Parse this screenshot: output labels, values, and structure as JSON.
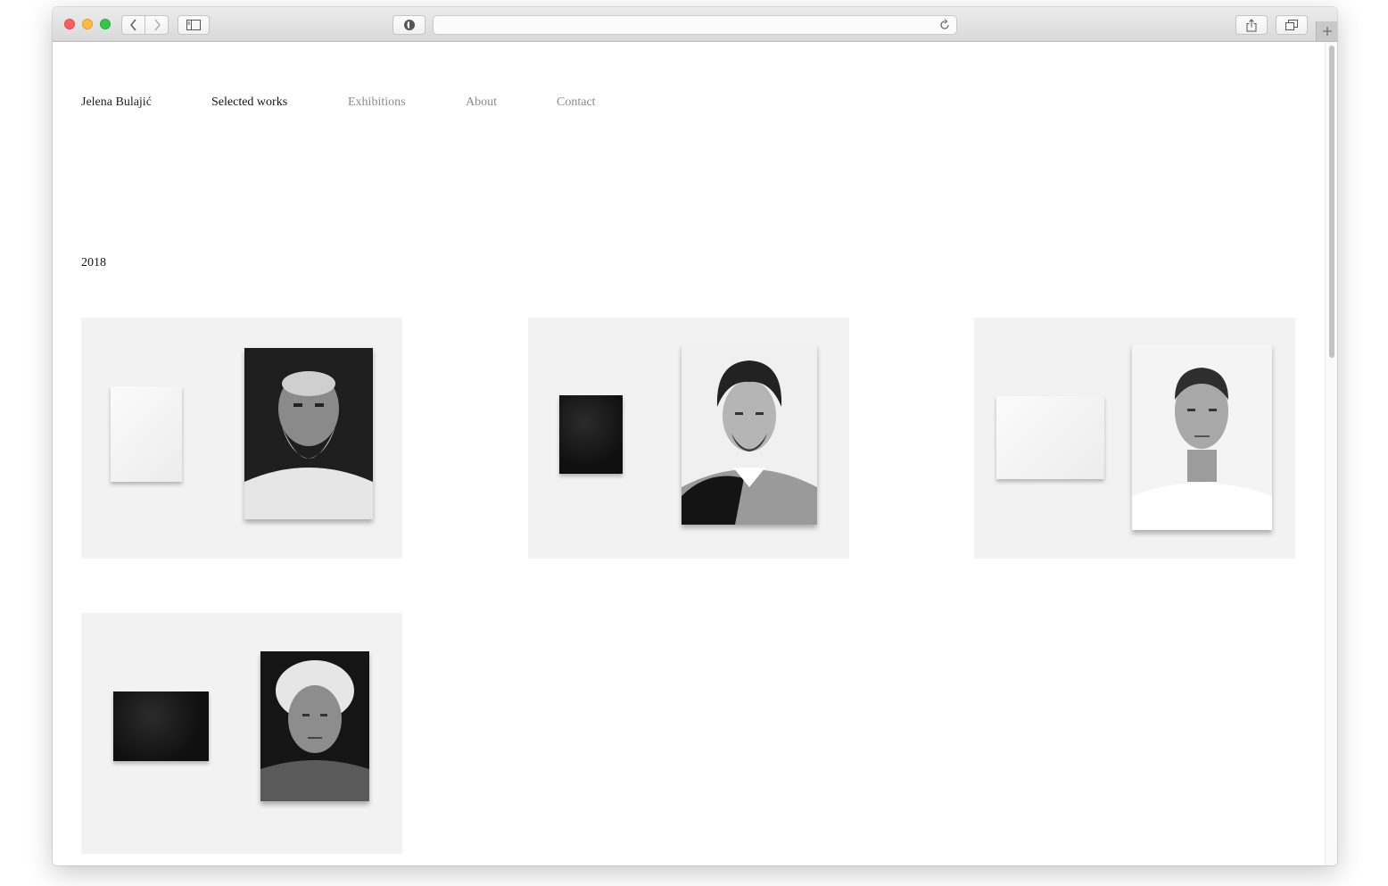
{
  "browser": {
    "back_icon": "chevron-left-icon",
    "forward_icon": "chevron-right-icon",
    "sidebar_icon": "sidebar-icon",
    "privacy_icon": "privacy-shield-icon",
    "reload_icon": "reload-icon",
    "share_icon": "share-icon",
    "tabs_icon": "tabs-icon",
    "newtab_icon": "plus-icon"
  },
  "nav": {
    "site_name": "Jelena Bulajić",
    "items": [
      "Selected works",
      "Exhibitions",
      "About",
      "Contact"
    ]
  },
  "section": {
    "year": "2018"
  },
  "works": [
    {
      "panel": "white",
      "portrait": "elderly bearded man"
    },
    {
      "panel": "black",
      "portrait": "young man with long hair"
    },
    {
      "panel": "white",
      "portrait": "young man with short hair"
    },
    {
      "panel": "black",
      "portrait": "elderly woman"
    }
  ],
  "colors": {
    "nav_active": "#111111",
    "nav_inactive": "#8a8a8a",
    "tile_background": "#f2f2f2"
  }
}
